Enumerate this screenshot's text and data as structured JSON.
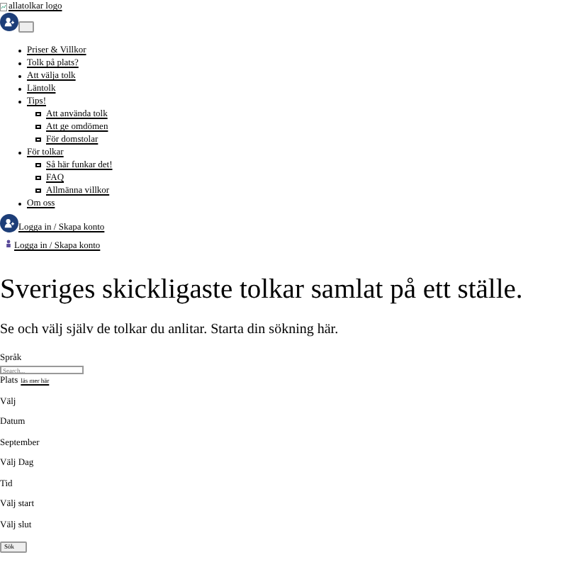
{
  "logo": {
    "alt": "allatolkar logo"
  },
  "nav": [
    {
      "label": "Priser & Villkor"
    },
    {
      "label": "Tolk på plats?"
    },
    {
      "label": "Att välja tolk"
    },
    {
      "label": "Läntolk"
    },
    {
      "label": "Tips!",
      "children": [
        {
          "label": "Att använda tolk"
        },
        {
          "label": "Att ge omdömen"
        },
        {
          "label": "För domstolar"
        }
      ]
    },
    {
      "label": "För tolkar",
      "children": [
        {
          "label": "Så här funkar det!"
        },
        {
          "label": "FAQ"
        },
        {
          "label": "Allmänna villkor"
        }
      ]
    },
    {
      "label": "Om oss"
    }
  ],
  "account_links": [
    "Logga in / Skapa konto",
    "Logga in / Skapa konto"
  ],
  "hero": {
    "title": "Sveriges skickligaste tolkar samlat på ett ställe.",
    "subtitle": "Se och välj själv de tolkar du anlitar. Starta din sökning här."
  },
  "form": {
    "language_label": "Språk",
    "search": {
      "placeholder": "Search..."
    },
    "place_label": "Plats",
    "read_more": "läs mer här",
    "fields": [
      "Välj",
      "Datum",
      "September",
      "Välj Dag",
      "Tid",
      "Välj start",
      "Välj slut"
    ],
    "submit": "Sök"
  }
}
